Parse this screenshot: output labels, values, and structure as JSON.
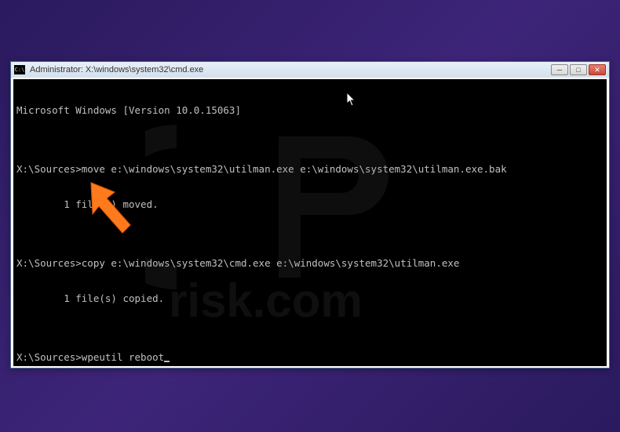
{
  "window": {
    "title": "Administrator: X:\\windows\\system32\\cmd.exe",
    "icon_label": "C:\\"
  },
  "console": {
    "header_line": "Microsoft Windows [Version 10.0.15063]",
    "lines": [
      "",
      "X:\\Sources>move e:\\windows\\system32\\utilman.exe e:\\windows\\system32\\utilman.exe.bak",
      "        1 file(s) moved.",
      "",
      "X:\\Sources>copy e:\\windows\\system32\\cmd.exe e:\\windows\\system32\\utilman.exe",
      "        1 file(s) copied.",
      ""
    ],
    "current_prompt": "X:\\Sources>",
    "current_command": "wpeutil reboot"
  },
  "watermark": {
    "logo_text": "PC",
    "domain_text": "risk.com"
  },
  "controls": {
    "minimize": "─",
    "maximize": "□",
    "close": "✕"
  }
}
